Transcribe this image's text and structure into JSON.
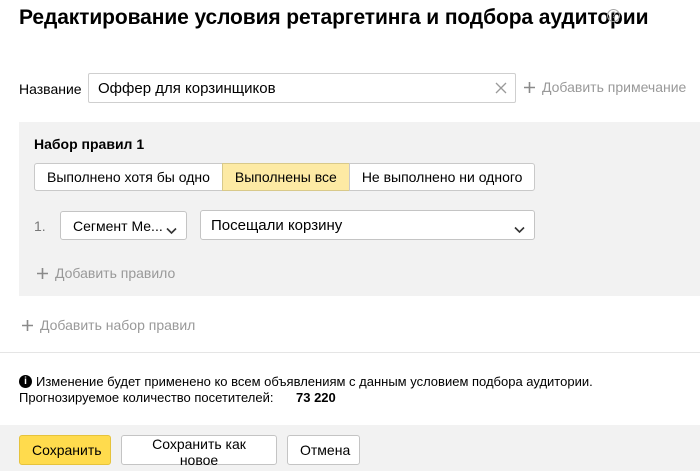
{
  "header": {
    "title": "Редактирование условия ретаргетинга и подбора аудитории",
    "help_glyph": "?"
  },
  "name_field": {
    "label": "Название",
    "value": "Оффер для корзинщиков"
  },
  "add_note_label": "Добавить примечание",
  "ruleset": {
    "title": "Набор правил 1",
    "modes": [
      {
        "label": "Выполнено хотя бы одно",
        "active": false
      },
      {
        "label": "Выполнены все",
        "active": true
      },
      {
        "label": "Не выполнено ни одного",
        "active": false
      }
    ],
    "rule": {
      "number": "1.",
      "segment_value": "Сегмент Ме...",
      "condition_value": "Посещали корзину"
    },
    "add_rule_label": "Добавить правило"
  },
  "add_ruleset_label": "Добавить набор правил",
  "notice": {
    "text": "Изменение будет применено ко всем объявлениям с данным условием подбора аудитории.",
    "forecast_label": "Прогнозируемое количество посетителей:",
    "forecast_value": "73 220"
  },
  "footer": {
    "save_label": "Сохранить",
    "save_new_label": "Сохранить как новое",
    "cancel_label": "Отмена"
  },
  "colors": {
    "accent_yellow": "#ffdb4d",
    "active_mode": "#fdeaa4",
    "panel_bg": "#f2f2f2",
    "muted_text": "#999999"
  },
  "icons": [
    "help-icon",
    "clear-icon",
    "plus-icon",
    "chevron-down-icon",
    "info-icon"
  ]
}
